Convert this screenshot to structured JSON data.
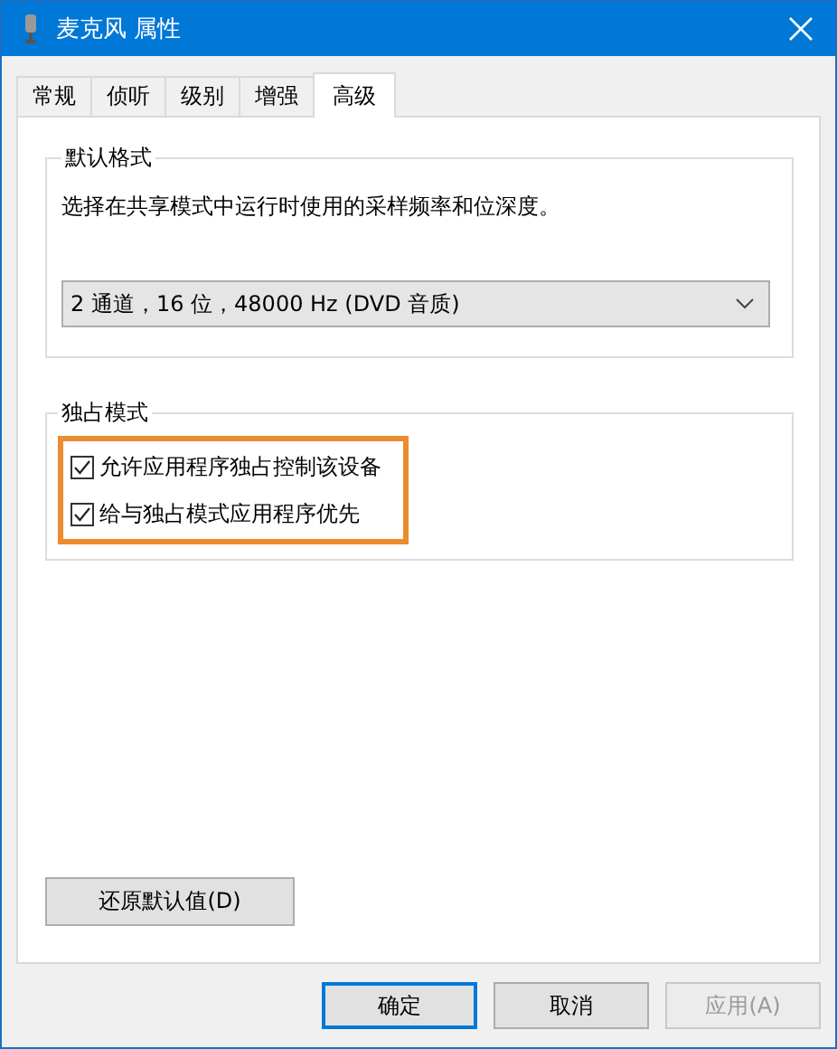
{
  "window": {
    "title": "麦克风 属性"
  },
  "tabs": [
    {
      "label": "常规",
      "selected": false
    },
    {
      "label": "侦听",
      "selected": false
    },
    {
      "label": "级别",
      "selected": false
    },
    {
      "label": "增强",
      "selected": false
    },
    {
      "label": "高级",
      "selected": true
    }
  ],
  "default_format": {
    "title": "默认格式",
    "description": "选择在共享模式中运行时使用的采样频率和位深度。",
    "value": "2 通道，16 位，48000 Hz (DVD 音质)"
  },
  "exclusive_mode": {
    "title": "独占模式",
    "options": [
      {
        "label": "允许应用程序独占控制该设备",
        "checked": true
      },
      {
        "label": "给与独占模式应用程序优先",
        "checked": true
      }
    ]
  },
  "restore_button": "还原默认值(D)",
  "buttons": [
    {
      "label": "确定",
      "default": true,
      "disabled": false
    },
    {
      "label": "取消",
      "default": false,
      "disabled": false
    },
    {
      "label": "应用(A)",
      "default": false,
      "disabled": true
    }
  ]
}
